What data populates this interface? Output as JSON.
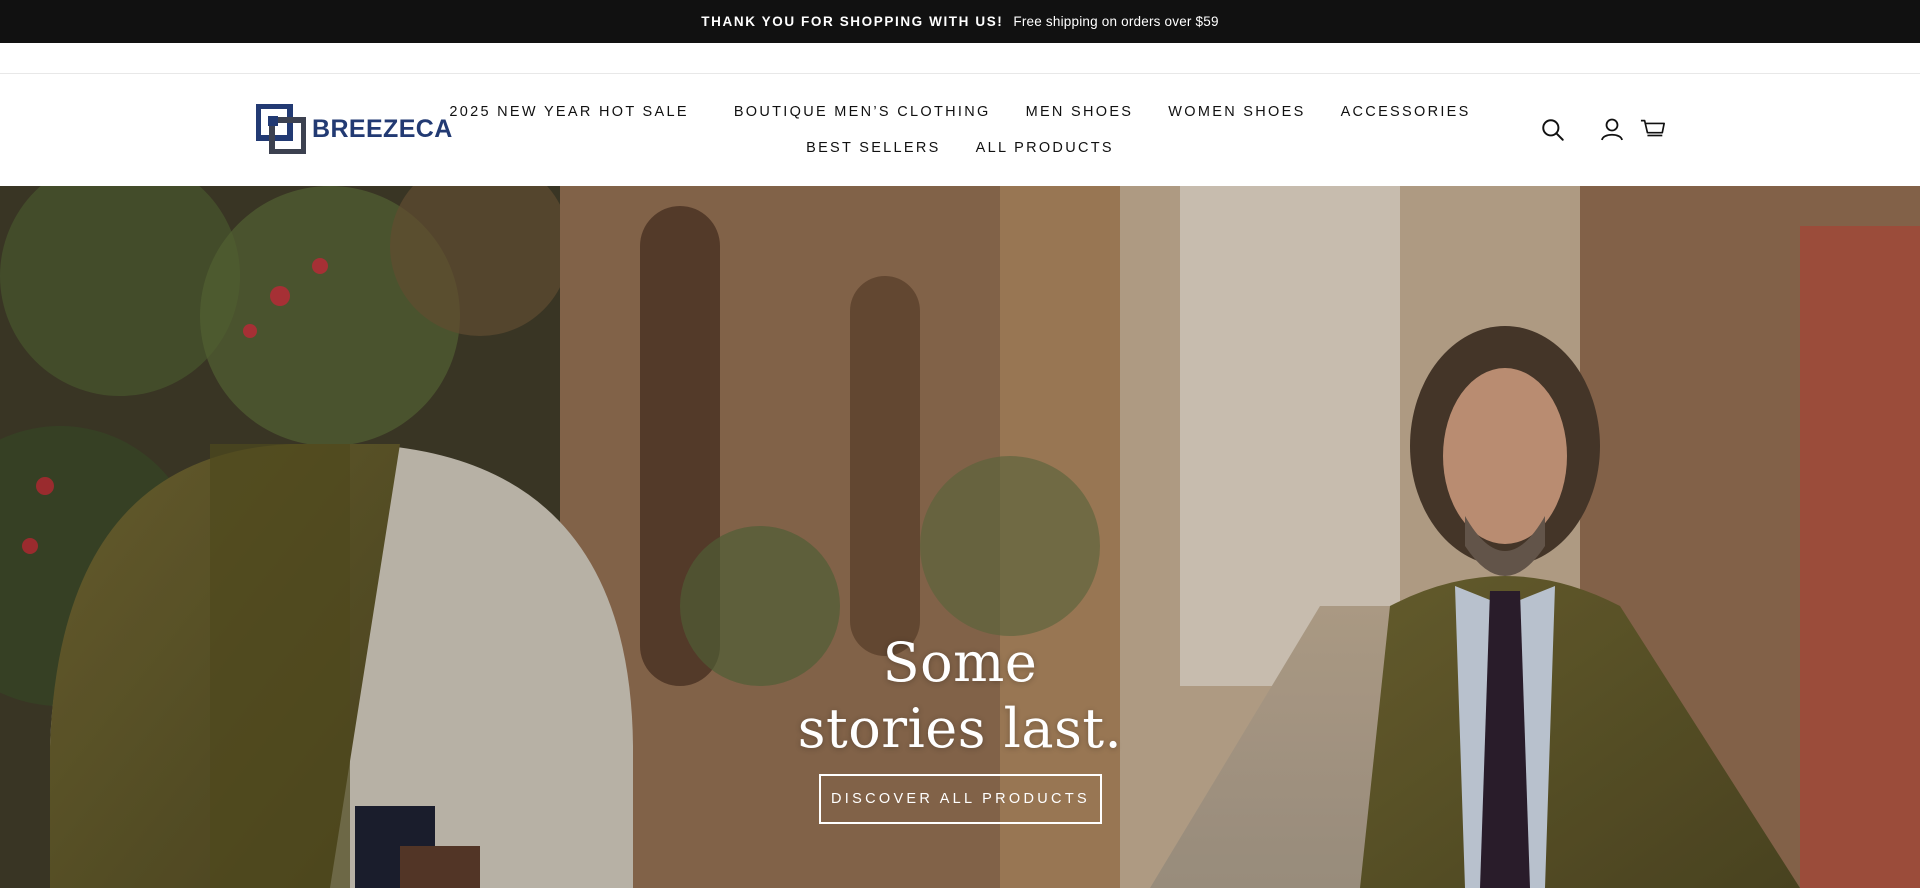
{
  "announcement": {
    "headline": "THANK YOU FOR SHOPPING WITH US!",
    "subtext": "Free shipping on orders over $59"
  },
  "header": {
    "logo_text": "BREEZECA",
    "nav_row1": [
      "2025 NEW YEAR HOT SALE",
      "BOUTIQUE MEN’S CLOTHING",
      "MEN SHOES",
      "WOMEN SHOES",
      "ACCESSORIES"
    ],
    "nav_row2": [
      "BEST SELLERS",
      "ALL PRODUCTS"
    ],
    "icons": [
      "search-icon",
      "account-icon",
      "cart-icon"
    ]
  },
  "hero": {
    "title_line1": "Some",
    "title_line2": "stories last.",
    "cta_label": "DISCOVER ALL PRODUCTS"
  },
  "colors": {
    "announcement_bg": "#111111",
    "logo_blue": "#223a73",
    "text": "#111111"
  }
}
